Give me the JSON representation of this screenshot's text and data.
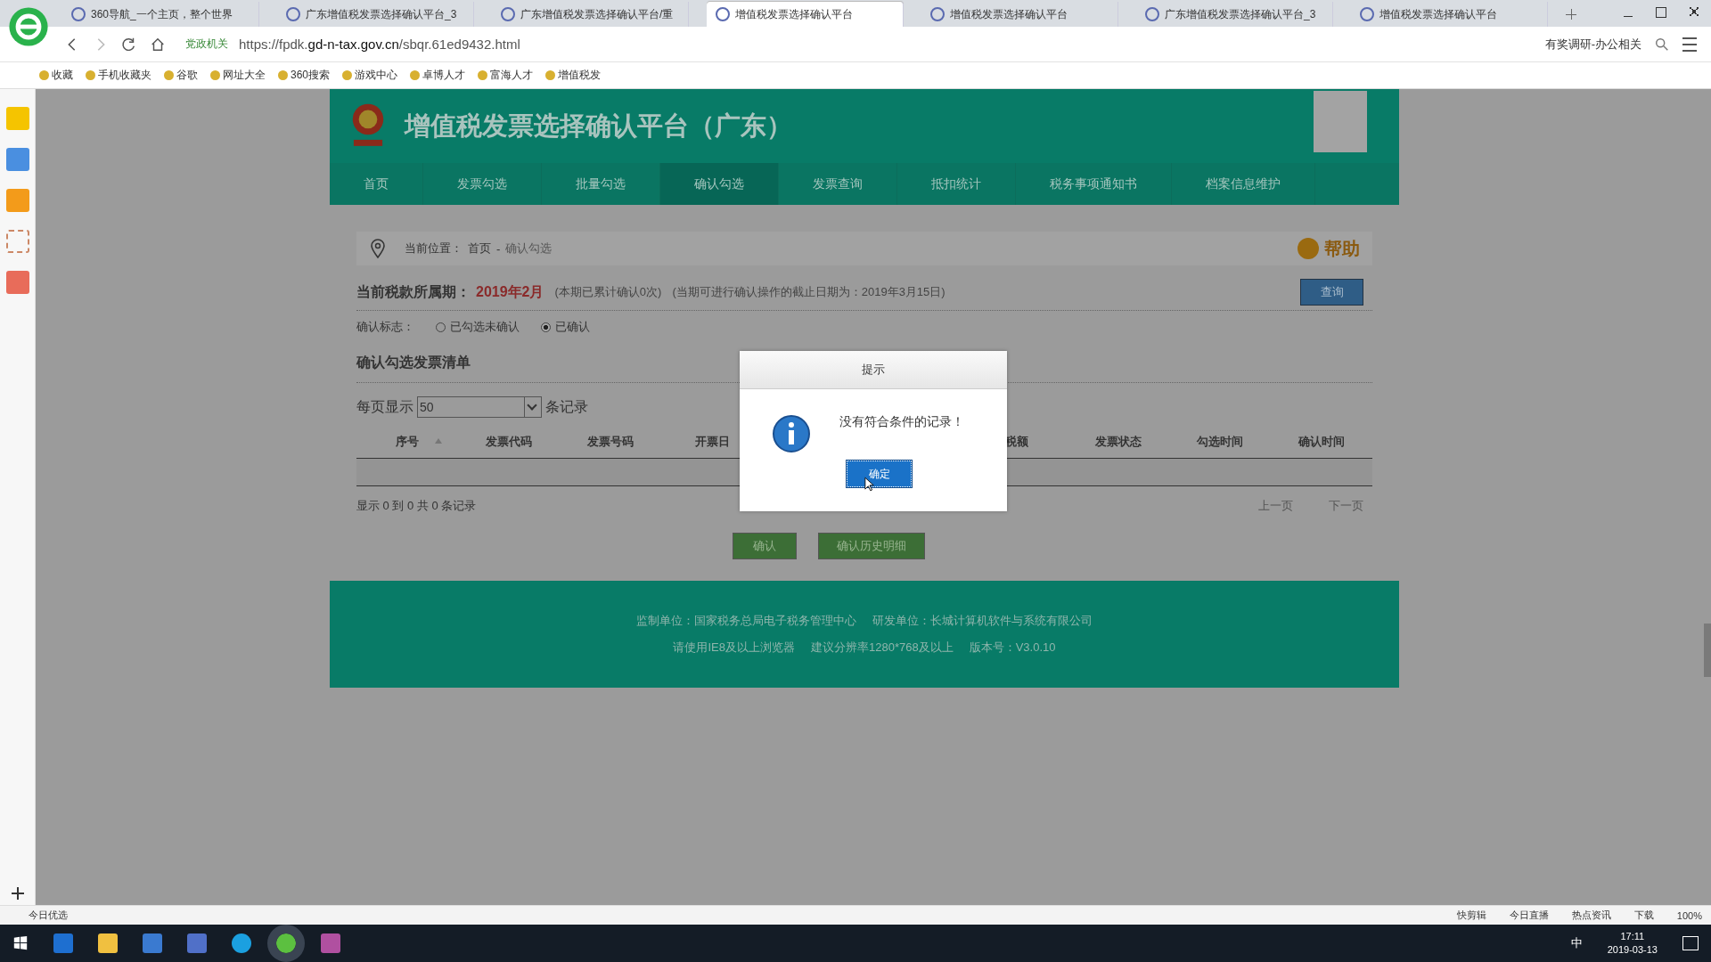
{
  "browser": {
    "tabs": [
      {
        "title": "360导航_一个主页，整个世界",
        "selected": false
      },
      {
        "title": "广东增值税发票选择确认平台_3",
        "selected": false
      },
      {
        "title": "广东增值税发票选择确认平台/重",
        "selected": false
      },
      {
        "title": "增值税发票选择确认平台",
        "selected": true
      },
      {
        "title": "增值税发票选择确认平台",
        "selected": false
      },
      {
        "title": "广东增值税发票选择确认平台_3",
        "selected": false
      },
      {
        "title": "增值税发票选择确认平台",
        "selected": false
      }
    ],
    "site_label": "党政机关",
    "url_host": "https://fpdk.",
    "url_domain": "gd-n-tax.gov.cn",
    "url_path": "/sbqr.61ed9432.html",
    "search_hint": "有奖调研-办公相关",
    "bookmarks": [
      "收藏",
      "手机收藏夹",
      "谷歌",
      "网址大全",
      "360搜索",
      "游戏中心",
      "卓博人才",
      "富海人才",
      "增值税发"
    ]
  },
  "page": {
    "title": "增值税发票选择确认平台（广东）",
    "nav": [
      {
        "label": "首页",
        "selected": false
      },
      {
        "label": "发票勾选",
        "selected": false
      },
      {
        "label": "批量勾选",
        "selected": false
      },
      {
        "label": "确认勾选",
        "selected": true
      },
      {
        "label": "发票查询",
        "selected": false
      },
      {
        "label": "抵扣统计",
        "selected": false
      },
      {
        "label": "税务事项通知书",
        "selected": false
      },
      {
        "label": "档案信息维护",
        "selected": false
      }
    ],
    "breadcrumb": {
      "label": "当前位置：",
      "home": "首页",
      "separator": "-",
      "current": "确认勾选"
    },
    "help": "帮助",
    "period": {
      "label": "当前税款所属期：",
      "value": "2019年2月",
      "count_note": "(本期已累计确认0次)",
      "deadline_note": "(当期可进行确认操作的截止日期为：2019年3月15日)"
    },
    "query_button": "查询",
    "confirm_flag": {
      "label": "确认标志：",
      "options": [
        {
          "label": "已勾选未确认",
          "selected": false
        },
        {
          "label": "已确认",
          "selected": true
        }
      ]
    },
    "list_title": "确认勾选发票清单",
    "page_size": {
      "before": "每页显示",
      "value": "50",
      "after": "条记录"
    },
    "table": {
      "columns": [
        "序号",
        "发票代码",
        "发票号码",
        "开票日",
        "",
        "",
        "税额",
        "发票状态",
        "勾选时间",
        "确认时间"
      ]
    },
    "summary": "显示 0 到 0 共 0 条记录",
    "prev": "上一页",
    "next": "下一页",
    "buttons": [
      "确认",
      "确认历史明细"
    ],
    "footer": {
      "line_1": [
        "监制单位：国家税务总局电子税务管理中心",
        "研发单位：长城计算机软件与系统有限公司"
      ],
      "line_2": [
        "请使用IE8及以上浏览器",
        "建议分辨率1280*768及以上",
        "版本号：V3.0.10"
      ]
    }
  },
  "dialog": {
    "title": "提示",
    "message": "没有符合条件的记录！",
    "ok": "确定"
  },
  "status_bar": {
    "left": "今日优选",
    "right": [
      "快剪辑",
      "今日直播",
      "热点资讯",
      "下载"
    ],
    "zoom": "100%"
  },
  "taskbar": {
    "ime": "中",
    "time": "17:11",
    "date": "2019-03-13"
  }
}
